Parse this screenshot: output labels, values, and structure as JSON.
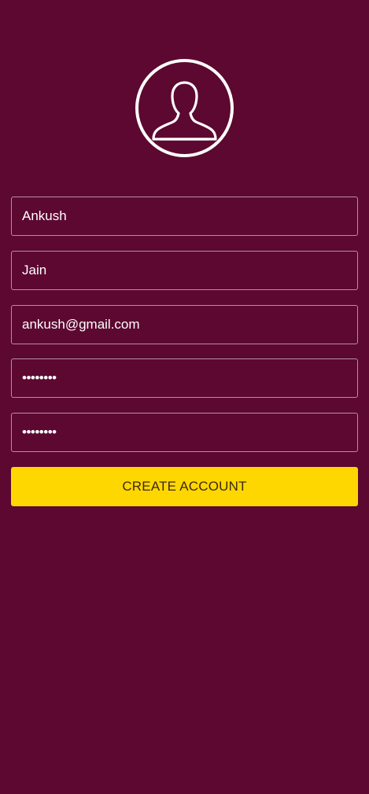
{
  "avatar": {
    "icon": "user-profile-icon"
  },
  "form": {
    "first_name": "Ankush",
    "last_name": "Jain",
    "email": "ankush@gmail.com",
    "password": "••••••••",
    "confirm_password": "••••••••"
  },
  "actions": {
    "create_account_label": "CREATE ACCOUNT"
  },
  "colors": {
    "background": "#5c0831",
    "button": "#ffd700",
    "field_border": "#ffffff"
  }
}
